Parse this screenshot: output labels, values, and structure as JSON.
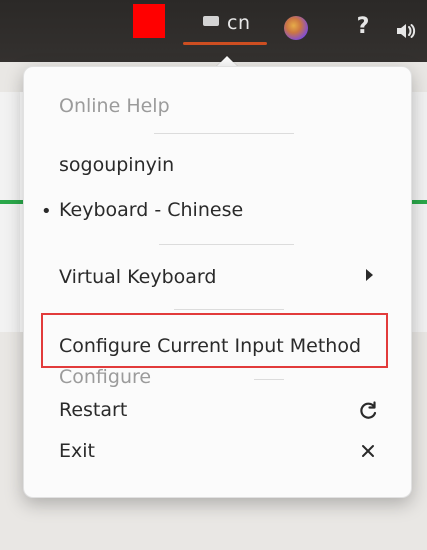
{
  "panel": {
    "input_indicator_text": "cn",
    "help_icon": "question-mark-icon",
    "volume_icon": "volume-icon",
    "app_icon": "app-circle-icon",
    "red_marker_color": "#ff0000",
    "accent_underline_color": "#e95420"
  },
  "menu": {
    "online_help": "Online Help",
    "sogoupinyin": "sogoupinyin",
    "keyboard_chinese": "Keyboard - Chinese",
    "virtual_keyboard": "Virtual Keyboard",
    "configure_current_input_method": "Configure Current Input Method",
    "configure": "Configure",
    "restart": "Restart",
    "exit": "Exit",
    "selected_bullet": "•"
  }
}
